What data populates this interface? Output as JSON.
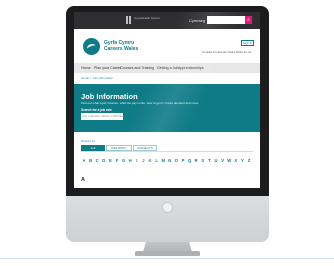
{
  "site": {
    "gov_logo_text": "Llywodraeth Cymru",
    "language_link": "Cymraeg",
    "search_button_icon": "search-icon",
    "brand_line1": "Gyrfa Cymru",
    "brand_line2": "Careers Wales",
    "sign_in_label": "Sign in",
    "utility_links": "Contact Us  Events  News  Work for us"
  },
  "nav": {
    "items": [
      "Home",
      "Plan your Career",
      "Courses and Training",
      "Getting a Job",
      "Apprenticeships"
    ]
  },
  "breadcrumb": "Home  >  Job Information",
  "hero": {
    "title": "Job Information",
    "subtitle": "Find out what a job involves, what the pay is like, how to get in, future demand and more.",
    "search_label": "Search for a job role",
    "search_placeholder": "For example: Nurse or Plumber"
  },
  "browse": {
    "label": "Browse by:",
    "tabs": [
      "A-Z",
      "INDUSTRY",
      "SUBJECTS"
    ],
    "active_tab": "A-Z"
  },
  "alphabet": [
    "A",
    "B",
    "C",
    "D",
    "E",
    "F",
    "G",
    "H",
    "I",
    "J",
    "K",
    "L",
    "M",
    "N",
    "O",
    "P",
    "Q",
    "R",
    "S",
    "T",
    "U",
    "V",
    "W",
    "X",
    "Y",
    "Z"
  ],
  "section_heading": "A",
  "colors": {
    "brand_teal": "#0e7b86",
    "top_bar": "#2f2f31",
    "search_accent": "#e0197d",
    "monitor_bezel": "#1c1c1e",
    "monitor_chin": "#d6d7da"
  }
}
